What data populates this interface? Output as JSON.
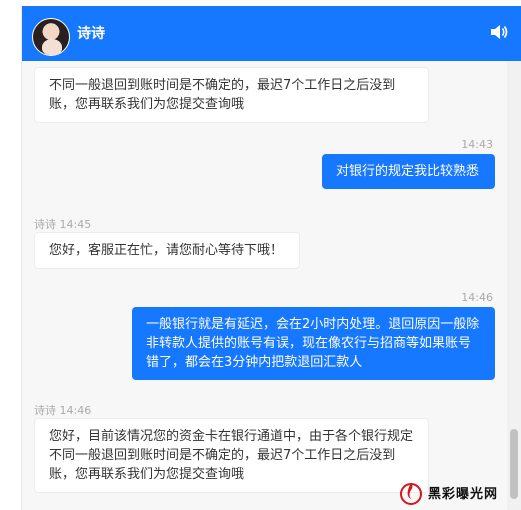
{
  "header": {
    "agent_name": "诗诗"
  },
  "messages": {
    "m1_text": "不同一般退回到账时间是不确定的，最迟7个工作日之后没到账，您再联系我们为您提交查询哦",
    "m2_time": "14:43",
    "m2_text": "对银行的规定我比较熟悉",
    "m3_meta": "诗诗 14:45",
    "m3_text": "您好，客服正在忙，请您耐心等待下哦！",
    "m4_time": "14:46",
    "m4_text": "一般银行就是有延迟，会在2小时内处理。退回原因一般除非转款人提供的账号有误，现在像农行与招商等如果账号错了，都会在3分钟内把款退回汇款人",
    "m5_meta": "诗诗 14:46",
    "m5_text": "您好，目前该情况您的资金卡在银行通道中，由于各个银行规定不同一般退回到账时间是不确定的，最迟7个工作日之后没到账，您再联系我们为您提交查询哦"
  },
  "watermark": {
    "text": "黑彩曝光网"
  },
  "colors": {
    "accent": "#1677ff",
    "background": "#f7f7f7"
  },
  "icons": {
    "header_avatar": "avatar",
    "sound": "speaker-icon",
    "watermark_logo": "flame-logo"
  }
}
